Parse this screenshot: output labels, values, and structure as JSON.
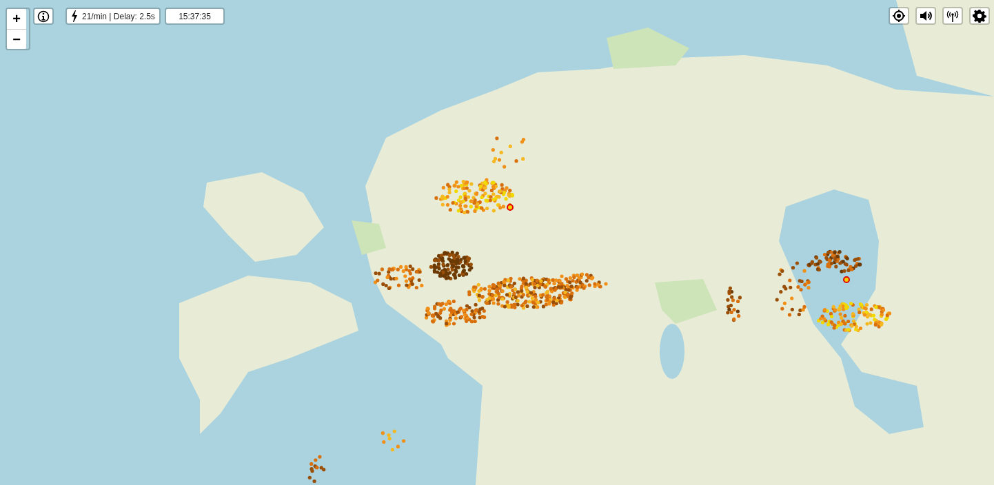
{
  "zoom_controls": [
    {
      "label": "+"
    },
    {
      "label": "−"
    }
  ],
  "status": {
    "rate": "21/min | Delay: 2.5s"
  },
  "clock": {
    "time": "15:37:35"
  },
  "toolbar": [
    {
      "kind": "locate"
    },
    {
      "kind": "sound"
    },
    {
      "kind": "signal"
    },
    {
      "kind": "settings"
    }
  ]
}
